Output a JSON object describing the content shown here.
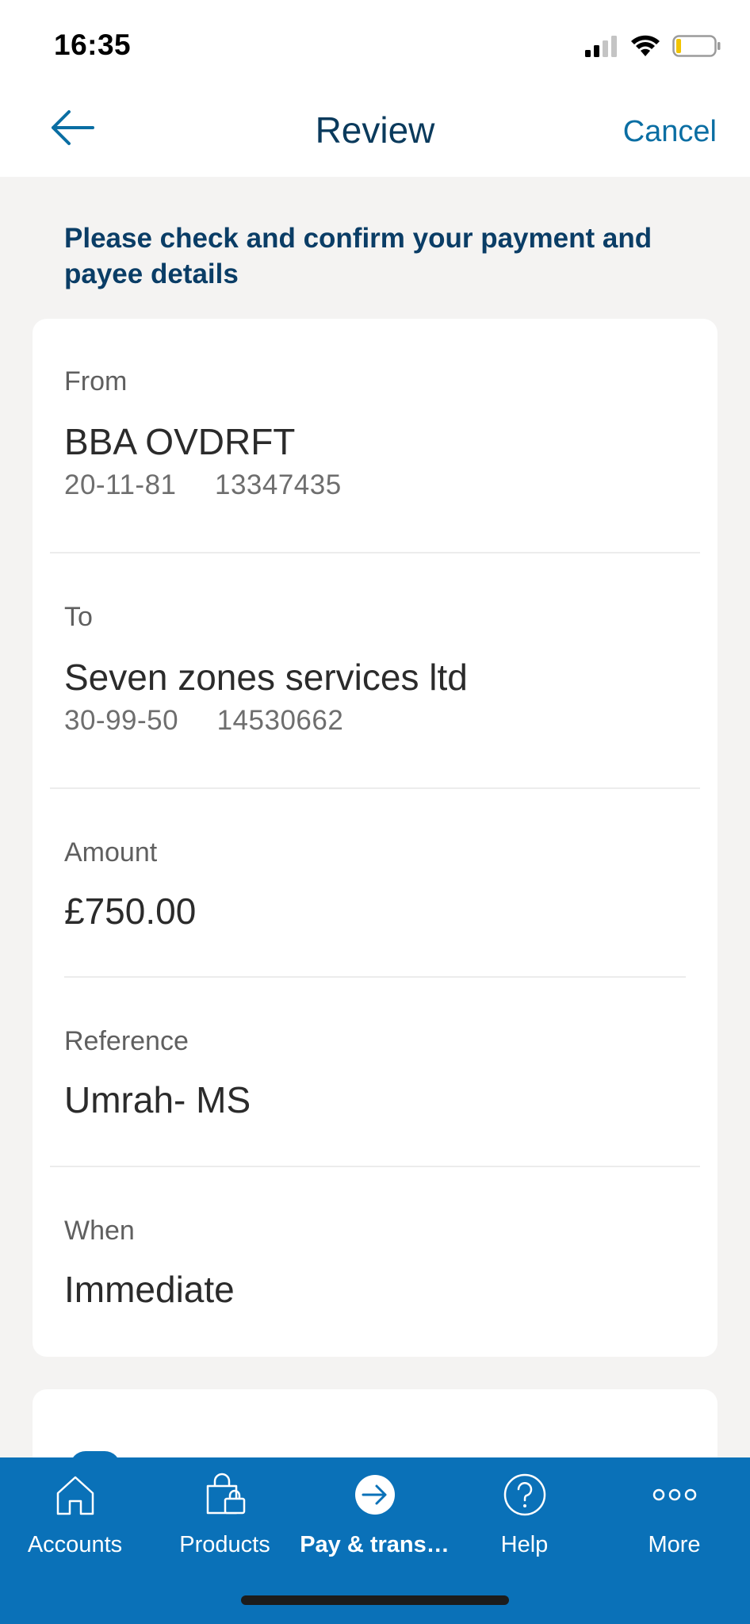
{
  "status_bar": {
    "time": "16:35"
  },
  "header": {
    "title": "Review",
    "cancel_label": "Cancel"
  },
  "instruction": "Please check and confirm your payment and payee details",
  "review": {
    "from": {
      "label": "From",
      "name": "BBA OVDRFT",
      "sort_code": "20-11-81",
      "account_number": "13347435"
    },
    "to": {
      "label": "To",
      "name": "Seven zones services ltd",
      "sort_code": "30-99-50",
      "account_number": "14530662"
    },
    "amount": {
      "label": "Amount",
      "value": "£750.00"
    },
    "reference": {
      "label": "Reference",
      "value": "Umrah- MS"
    },
    "when": {
      "label": "When",
      "value": "Immediate"
    }
  },
  "tab_bar": {
    "tabs": [
      {
        "label": "Accounts",
        "icon": "home-icon"
      },
      {
        "label": "Products",
        "icon": "shopping-bag-icon"
      },
      {
        "label": "Pay & trans…",
        "icon": "arrow-circle-icon",
        "active": true
      },
      {
        "label": "Help",
        "icon": "question-circle-icon"
      },
      {
        "label": "More",
        "icon": "ellipsis-icon"
      }
    ]
  },
  "colors": {
    "brand_blue": "#0a71b8",
    "heading_navy": "#0a3d66",
    "link_blue": "#0a6ea3",
    "background": "#f4f3f2"
  }
}
